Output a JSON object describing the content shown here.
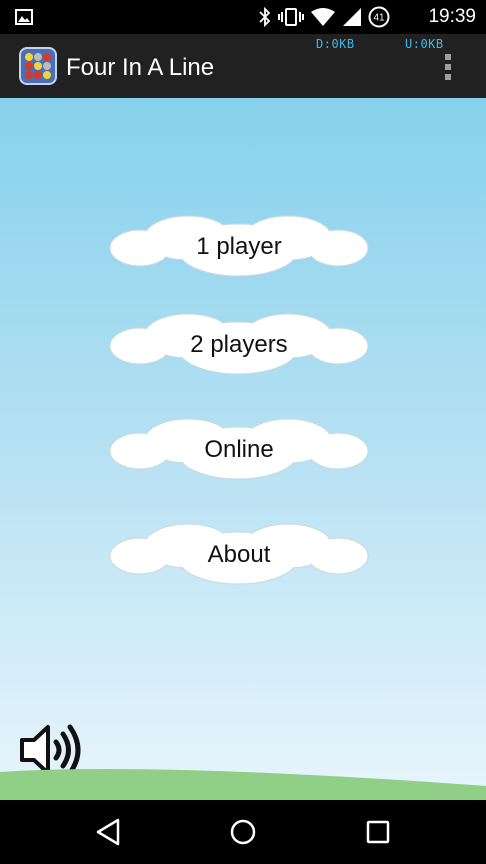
{
  "status_bar": {
    "time": "19:39",
    "battery_level": "41",
    "icons": [
      "image-icon",
      "bluetooth-icon",
      "vibrate-icon",
      "wifi-icon",
      "cell-signal-icon",
      "battery-icon"
    ]
  },
  "app_bar": {
    "title": "Four In A Line",
    "net_down": "D:0KB",
    "net_up": "U:0KB",
    "icon": "four-in-a-line-app-icon"
  },
  "menu": {
    "buttons": [
      {
        "label": "1 player"
      },
      {
        "label": "2 players"
      },
      {
        "label": "Online"
      },
      {
        "label": "About"
      }
    ]
  },
  "sound": {
    "icon": "speaker-volume-icon"
  },
  "nav": {
    "back": "back-icon",
    "home": "home-icon",
    "recents": "recents-icon"
  },
  "colors": {
    "sky_top": "#86d1ec",
    "sky_bottom": "#e8f5fc",
    "hill": "#8fcf86",
    "app_bar": "#212121",
    "net_text": "#3fb8e8"
  }
}
